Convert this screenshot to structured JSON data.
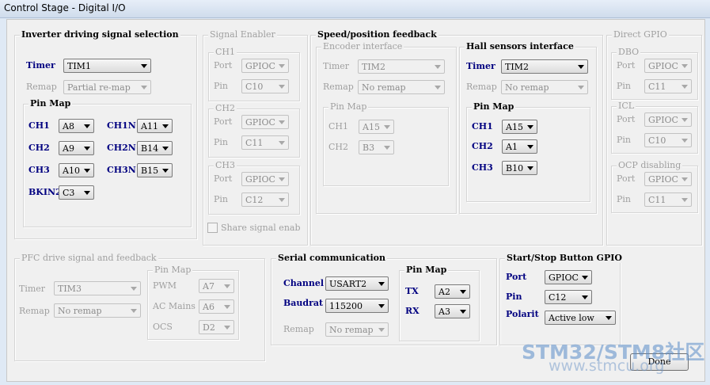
{
  "window": {
    "title": "Control Stage - Digital I/O"
  },
  "inverter": {
    "title": "Inverter driving signal selection",
    "timer_label": "Timer",
    "timer": "TIM1",
    "remap_label": "Remap",
    "remap": "Partial re-map",
    "pinmap_title": "Pin Map",
    "ch1_label": "CH1",
    "ch1": "A8",
    "ch1n_label": "CH1N",
    "ch1n": "A11",
    "ch2_label": "CH2",
    "ch2": "A9",
    "ch2n_label": "CH2N",
    "ch2n": "B14",
    "ch3_label": "CH3",
    "ch3": "A10",
    "ch3n_label": "CH3N",
    "ch3n": "B15",
    "bkin2_label": "BKIN2",
    "bkin2": "C3"
  },
  "signal_enabler": {
    "title": "Signal Enabler",
    "ch1_title": "CH1",
    "ch1_port_label": "Port",
    "ch1_port": "GPIOC",
    "ch1_pin_label": "Pin",
    "ch1_pin": "C10",
    "ch2_title": "CH2",
    "ch2_port_label": "Port",
    "ch2_port": "GPIOC",
    "ch2_pin_label": "Pin",
    "ch2_pin": "C11",
    "ch3_title": "CH3",
    "ch3_port_label": "Port",
    "ch3_port": "GPIOC",
    "ch3_pin_label": "Pin",
    "ch3_pin": "C12",
    "share_label": "Share signal enab"
  },
  "speed_feedback": {
    "title": "Speed/position feedback",
    "encoder_title": "Encoder interface",
    "enc_timer_label": "Timer",
    "enc_timer": "TIM2",
    "enc_remap_label": "Remap",
    "enc_remap": "No remap",
    "enc_pinmap_title": "Pin Map",
    "enc_ch1_label": "CH1",
    "enc_ch1": "A15",
    "enc_ch2_label": "CH2",
    "enc_ch2": "B3",
    "hall_title": "Hall sensors interface",
    "hall_timer_label": "Timer",
    "hall_timer": "TIM2",
    "hall_remap_label": "Remap",
    "hall_remap": "No remap",
    "hall_pinmap_title": "Pin Map",
    "hall_ch1_label": "CH1",
    "hall_ch1": "A15",
    "hall_ch2_label": "CH2",
    "hall_ch2": "A1",
    "hall_ch3_label": "CH3",
    "hall_ch3": "B10"
  },
  "direct_gpio": {
    "title": "Direct GPIO",
    "dbo_title": "DBO",
    "dbo_port_label": "Port",
    "dbo_port": "GPIOC",
    "dbo_pin_label": "Pin",
    "dbo_pin": "C11",
    "icl_title": "ICL",
    "icl_port_label": "Port",
    "icl_port": "GPIOC",
    "icl_pin_label": "Pin",
    "icl_pin": "C10",
    "ocp_title": "OCP disabling",
    "ocp_port_label": "Port",
    "ocp_port": "GPIOC",
    "ocp_pin_label": "Pin",
    "ocp_pin": "C11"
  },
  "pfc": {
    "title": "PFC drive signal and feedback",
    "timer_label": "Timer",
    "timer": "TIM3",
    "remap_label": "Remap",
    "remap": "No remap",
    "pinmap_title": "Pin Map",
    "pwm_label": "PWM",
    "pwm": "A7",
    "acmains_label": "AC Mains",
    "acmains": "A6",
    "ocs_label": "OCS",
    "ocs": "D2"
  },
  "serial": {
    "title": "Serial communication",
    "channel_label": "Channel",
    "channel": "USART2",
    "baud_label": "Baudrat",
    "baud": "115200",
    "remap_label": "Remap",
    "remap": "No remap",
    "pinmap_title": "Pin Map",
    "tx_label": "TX",
    "tx": "A2",
    "rx_label": "RX",
    "rx": "A3"
  },
  "startstop": {
    "title": "Start/Stop Button GPIO",
    "port_label": "Port",
    "port": "GPIOC",
    "pin_label": "Pin",
    "pin": "C12",
    "polarity_label": "Polarit",
    "polarity": "Active low"
  },
  "done_label": "Done",
  "watermark": {
    "line1": "STM32/STM8社区",
    "line2": "www.stmcu.org"
  }
}
